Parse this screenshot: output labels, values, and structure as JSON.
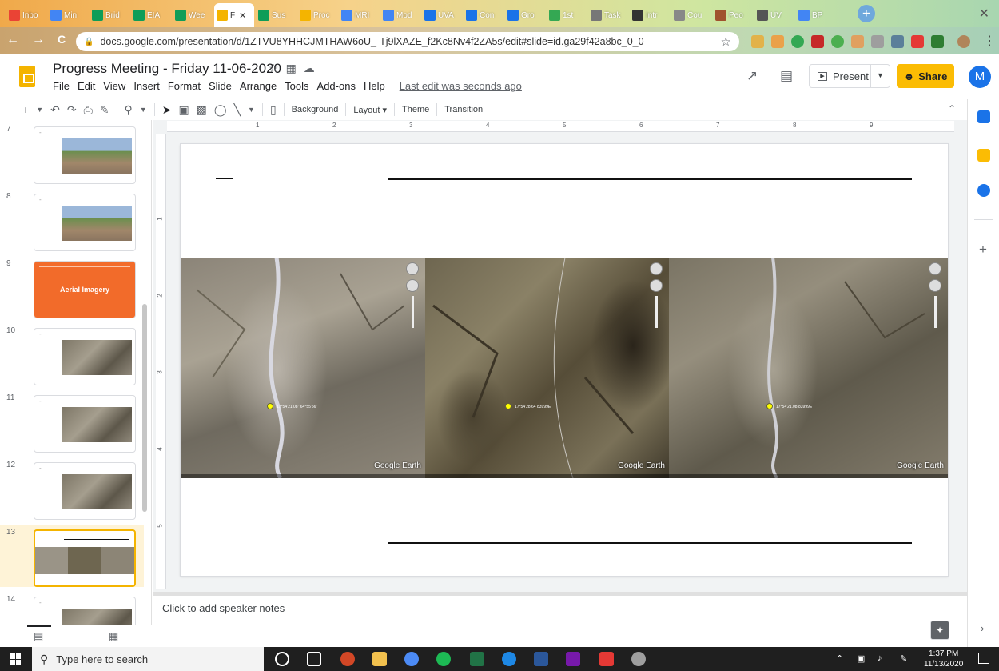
{
  "browser": {
    "tabs": [
      {
        "label": "Inbo",
        "color": "#ea4335"
      },
      {
        "label": "Min",
        "color": "#4285f4"
      },
      {
        "label": "Brid",
        "color": "#0f9d58"
      },
      {
        "label": "EIA",
        "color": "#0f9d58"
      },
      {
        "label": "Wee",
        "color": "#0f9d58"
      },
      {
        "label": "F",
        "color": "#f4b400"
      },
      {
        "label": "Sus",
        "color": "#0f9d58"
      },
      {
        "label": "Proc",
        "color": "#f4b400"
      },
      {
        "label": "MRI",
        "color": "#4285f4"
      },
      {
        "label": "Mod",
        "color": "#4285f4"
      },
      {
        "label": "UVA",
        "color": "#1a73e8"
      },
      {
        "label": "Con",
        "color": "#1a73e8"
      },
      {
        "label": "Gro",
        "color": "#1a73e8"
      },
      {
        "label": "1st",
        "color": "#34a853"
      },
      {
        "label": "Task",
        "color": "#777777"
      },
      {
        "label": "Intr",
        "color": "#333333"
      },
      {
        "label": "Cou",
        "color": "#888888"
      },
      {
        "label": "Peo",
        "color": "#a0522d"
      },
      {
        "label": "UV",
        "color": "#555555"
      },
      {
        "label": "BP",
        "color": "#4285f4"
      }
    ],
    "new_tab_symbol": "+",
    "close_symbol": "✕",
    "url": "docs.google.com/presentation/d/1ZTVU8YHHCJMTHAW6oU_-Tj9lXAZE_f2Kc8Nv4f2ZA5s/edit#slide=id.ga29f42a8bc_0_0",
    "nav": {
      "back": "←",
      "forward": "→",
      "reload": "C"
    }
  },
  "app": {
    "title": "Progress Meeting - Friday 11-06-2020",
    "menu": [
      "File",
      "Edit",
      "View",
      "Insert",
      "Format",
      "Slide",
      "Arrange",
      "Tools",
      "Add-ons",
      "Help"
    ],
    "last_edit": "Last edit was seconds ago",
    "present_label": "Present",
    "share_label": "Share",
    "avatar_letter": "M",
    "brand_color": "#f4b400",
    "share_color": "#fbbc04"
  },
  "toolbar": {
    "background_label": "Background",
    "layout_label": "Layout",
    "theme_label": "Theme",
    "transition_label": "Transition"
  },
  "ruler": {
    "h": [
      "1",
      "2",
      "3",
      "4",
      "5",
      "6",
      "7",
      "8",
      "9"
    ],
    "v": [
      "1",
      "2",
      "3",
      "4",
      "5"
    ]
  },
  "filmstrip": {
    "slides": [
      {
        "number": "7",
        "kind": "photo"
      },
      {
        "number": "8",
        "kind": "photo"
      },
      {
        "number": "9",
        "kind": "title",
        "title": "Aerial Imagery"
      },
      {
        "number": "10",
        "kind": "aerial"
      },
      {
        "number": "11",
        "kind": "aerial"
      },
      {
        "number": "12",
        "kind": "aerial"
      },
      {
        "number": "13",
        "kind": "triple",
        "selected": true
      },
      {
        "number": "14",
        "kind": "aerial"
      }
    ]
  },
  "slide": {
    "images": [
      {
        "caption": "Google Earth",
        "coord": "17°54'21.08\" 64°55'56\""
      },
      {
        "caption": "Google Earth",
        "coord": "17°54'28.64 83999E"
      },
      {
        "caption": "Google Earth",
        "coord": "17°54'21.08 83999E"
      }
    ]
  },
  "notes": {
    "placeholder": "Click to add speaker notes"
  },
  "taskbar": {
    "search_placeholder": "Type here to search",
    "time": "1:37 PM",
    "date": "11/13/2020"
  }
}
